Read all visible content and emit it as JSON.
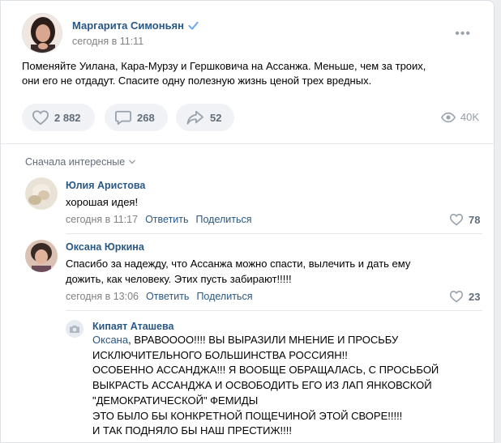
{
  "post": {
    "author": "Маргарита Симоньян",
    "date": "сегодня в 11:11",
    "text_line1": "Поменяйте Уилана, Кара-Мурзу и Гершковича на Ассанжа. Меньше, чем за троих,",
    "text_line2": "они его не отдадут. Спасите одну полезную жизнь ценой трех вредных.",
    "likes": "2 882",
    "comments": "268",
    "shares": "52",
    "views": "40K",
    "more_label": "•••"
  },
  "comments_sort": "Сначала интересные",
  "comments": [
    {
      "author": "Юлия Аристова",
      "text": "хорошая идея!",
      "date": "сегодня в 11:17",
      "reply_label": "Ответить",
      "share_label": "Поделиться",
      "likes": "78"
    },
    {
      "author": "Оксана Юркина",
      "text_line1": "Спасибо за надежду, что Ассанжа можно спасти, вылечить и дать ему",
      "text_line2": "дожить, как человеку. Этих пусть забирают!!!!!",
      "date": "сегодня в 13:06",
      "reply_label": "Ответить",
      "share_label": "Поделиться",
      "likes": "23"
    }
  ],
  "reply": {
    "author": "Кипаят Аташева",
    "mention": "Оксана",
    "line1_rest": ", ВРАВОООО!!!! ВЫ ВЫРАЗИЛИ МНЕНИЕ И ПРОСЬБУ",
    "line2": "ИСКЛЮЧИТЕЛЬНОГО БОЛЬШИНСТВА РОССИЯН!!",
    "line3": "ОСОБЕННО АССАНДЖА!!! Я ВООБЩЕ ОБРАЩАЛАСЬ, С ПРОСЬБОЙ",
    "line4": "ВЫКРАСТЬ АССАНДЖА И ОСВОБОДИТЬ ЕГО ИЗ ЛАП ЯНКОВСКОЙ",
    "line5": "\"ДЕМОКРАТИЧЕСКОЙ\" ФЕМИДЫ",
    "line6": "ЭТО БЫЛО БЫ КОНКРЕТНОЙ ПОЩЕЧИНОЙ ЭТОЙ СВОРЕ!!!!!",
    "line7": "И ТАК ПОДНЯЛО БЫ НАШ ПРЕСТИЖ!!!!"
  },
  "colors": {
    "link": "#2a5885",
    "muted": "#828282",
    "button_bg": "#f0f2f5",
    "icon": "#626d7a",
    "background": "#edeef0"
  }
}
